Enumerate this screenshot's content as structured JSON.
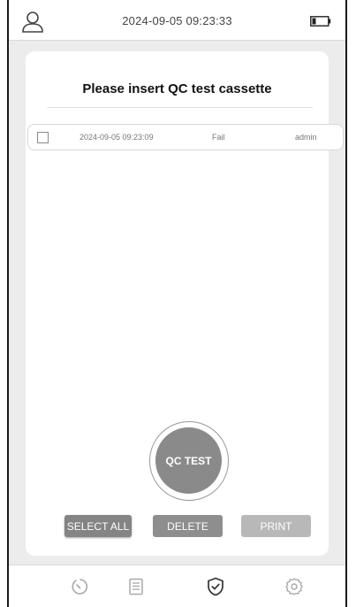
{
  "status_bar": {
    "datetime": "2024-09-05  09:23:33",
    "user_icon": "user-icon",
    "battery_icon": "battery-icon"
  },
  "card": {
    "title": "Please insert QC test cassette"
  },
  "records": [
    {
      "checked": false,
      "time": "2024-09-05 09:23:09",
      "result": "Fail",
      "user": "admin"
    }
  ],
  "qc_button": {
    "label": "QC TEST"
  },
  "actions": {
    "select_all": "SELECT ALL",
    "delete": "DELETE",
    "print": "PRINT"
  },
  "nav": [
    {
      "icon": "history-icon"
    },
    {
      "icon": "records-list-icon"
    },
    {
      "icon": "shield-check-icon",
      "active": true
    },
    {
      "icon": "gear-icon"
    }
  ],
  "colors": {
    "background": "#ececec",
    "card": "#ffffff",
    "button_dark": "#848484",
    "button_mid": "#8e8e8e",
    "button_light": "#b8b8b8",
    "active_nav": "#333333",
    "inactive_nav": "#a8a8a8"
  }
}
